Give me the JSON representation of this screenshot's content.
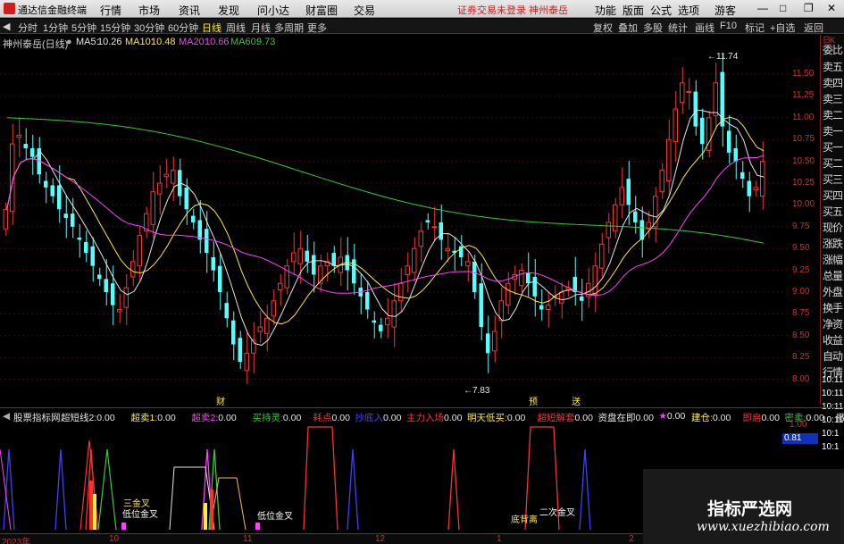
{
  "app": {
    "title": "通达信金融终端",
    "menus": [
      "行情",
      "市场",
      "资讯",
      "发现",
      "问小达",
      "财富圈",
      "交易"
    ],
    "center_text": [
      "证券交易未登录",
      "神州泰岳"
    ],
    "right_menus": [
      "功能",
      "版面",
      "公式",
      "选项",
      "游客"
    ]
  },
  "toolbar": {
    "periods": [
      "分时",
      "1分钟",
      "5分钟",
      "15分钟",
      "30分钟",
      "60分钟",
      "日线",
      "周线",
      "月线",
      "多周期",
      "更多"
    ],
    "selected": "日线",
    "right_tools": [
      "复权",
      "叠加",
      "多股",
      "统计",
      "画线",
      "F10",
      "标记",
      "+自选",
      "返回"
    ]
  },
  "info": {
    "stock": "神州泰岳(日线)",
    "ma5_label": "MA5:",
    "ma5": "10.26",
    "ma10_label": "MA10:",
    "ma10": "10.48",
    "ma20_label": "MA20:",
    "ma20": "10.66",
    "ma60_label": "MA60:",
    "ma60": "9.73"
  },
  "right_panel": [
    "委比",
    "卖五",
    "卖四",
    "卖三",
    "卖二",
    "卖一",
    "买一",
    "买二",
    "买三",
    "买四",
    "买五",
    "现价",
    "涨跌",
    "涨幅",
    "总量",
    "外盘",
    "换手",
    "净资",
    "收益",
    "自动",
    "行情"
  ],
  "right_panel_top": "日K",
  "right_values": [
    "10:11",
    "10:11",
    "10:11",
    "10:11",
    "10:1",
    "10:1"
  ],
  "price_axis": [
    "11.50",
    "11.25",
    "11.00",
    "10.75",
    "10.50",
    "10.25",
    "10.00",
    "9.75",
    "9.50",
    "9.25",
    "9.00",
    "8.75",
    "8.50",
    "8.25",
    "8.00"
  ],
  "annotations": {
    "high": "11.74",
    "low": "7.83",
    "mark1": "财",
    "mark2": "预",
    "mark3": "送"
  },
  "indicator": {
    "name": "股票指标网",
    "items": [
      {
        "label": "超短线2:",
        "value": "0.00",
        "color": "#e6e6e6"
      },
      {
        "label": "超卖1:",
        "value": "0.00",
        "color": "#ffeb3b"
      },
      {
        "label": "超卖2:",
        "value": "0.00",
        "color": "#ff40ff"
      },
      {
        "label": "买持灵:",
        "value": "0.00",
        "color": "#30d030"
      },
      {
        "label": "耗点",
        "value": "0.00",
        "color": "#ff3030"
      },
      {
        "label": "抄底入",
        "value": "0.00",
        "color": "#4040ff"
      },
      {
        "label": "主力入场",
        "value": "0.00",
        "color": "#ff3030"
      },
      {
        "label": "明天低买:",
        "value": "0.00",
        "color": "#ffeb3b"
      },
      {
        "label": "超短解套",
        "value": "0.00",
        "color": "#ff3030"
      },
      {
        "label": "资盘在即",
        "value": "0.00",
        "color": "#e6e6e6"
      },
      {
        "label": "★",
        "value": "0.00",
        "color": "#ff40ff"
      },
      {
        "label": "建仓:",
        "value": "0.00",
        "color": "#ffeb3b"
      },
      {
        "label": "即启",
        "value": "0.00",
        "color": "#ff3030"
      },
      {
        "label": "密卖:",
        "value": "0.00",
        "color": "#30d030"
      },
      {
        "label": "",
        "value": "撤出",
        "color": "#ff40ff"
      }
    ],
    "axis_top": "1.00",
    "axis_val": "0.81"
  },
  "signals": [
    "三金叉",
    "低位金叉",
    "低位金叉",
    "底背离",
    "二次金叉"
  ],
  "date_axis": [
    "2023年",
    "10",
    "11",
    "12",
    "1",
    "2"
  ],
  "watermark": {
    "line1": "指标严选网",
    "line2": "www.xuezhibiao.com"
  }
}
